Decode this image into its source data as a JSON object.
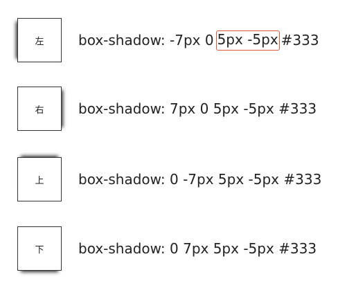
{
  "examples": [
    {
      "label": "左",
      "code_prefix": "box-shadow: -7px 0",
      "code_highlight": "5px -5px",
      "code_suffix": "#333"
    },
    {
      "label": "右",
      "code": "box-shadow: 7px 0 5px -5px #333"
    },
    {
      "label": "上",
      "code": "box-shadow: 0 -7px 5px -5px #333"
    },
    {
      "label": "下",
      "code": "box-shadow: 0 7px 5px -5px #333"
    }
  ],
  "colors": {
    "shadow": "#333333",
    "highlight_border": "#d9583b"
  }
}
